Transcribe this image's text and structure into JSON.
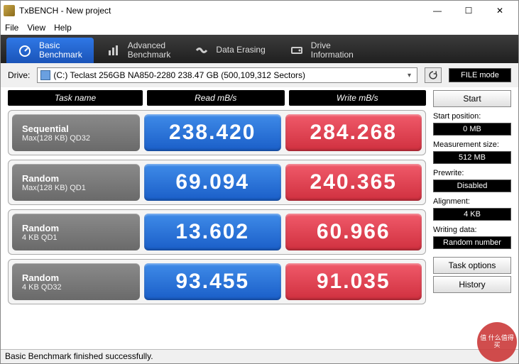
{
  "window": {
    "title": "TxBENCH - New project"
  },
  "menu": {
    "file": "File",
    "view": "View",
    "help": "Help"
  },
  "tabs": {
    "basic": "Basic\nBenchmark",
    "advanced": "Advanced\nBenchmark",
    "erasing": "Data Erasing",
    "driveinfo": "Drive\nInformation"
  },
  "drive": {
    "label": "Drive:",
    "selected": "(C:) Teclast 256GB NA850-2280  238.47 GB (500,109,312 Sectors)"
  },
  "filemode": "FILE mode",
  "headers": {
    "name": "Task name",
    "read": "Read mB/s",
    "write": "Write mB/s"
  },
  "rows": [
    {
      "title": "Sequential",
      "sub": "Max(128 KB) QD32",
      "read": "238.420",
      "write": "284.268"
    },
    {
      "title": "Random",
      "sub": "Max(128 KB) QD1",
      "read": "69.094",
      "write": "240.365"
    },
    {
      "title": "Random",
      "sub": "4 KB QD1",
      "read": "13.602",
      "write": "60.966"
    },
    {
      "title": "Random",
      "sub": "4 KB QD32",
      "read": "93.455",
      "write": "91.035"
    }
  ],
  "side": {
    "start": "Start",
    "startpos_lbl": "Start position:",
    "startpos_val": "0 MB",
    "meassize_lbl": "Measurement size:",
    "meassize_val": "512 MB",
    "prewrite_lbl": "Prewrite:",
    "prewrite_val": "Disabled",
    "align_lbl": "Alignment:",
    "align_val": "4 KB",
    "writedata_lbl": "Writing data:",
    "writedata_val": "Random number",
    "taskopt": "Task options",
    "history": "History"
  },
  "status": "Basic Benchmark finished successfully.",
  "watermark": "值 什么值得买"
}
